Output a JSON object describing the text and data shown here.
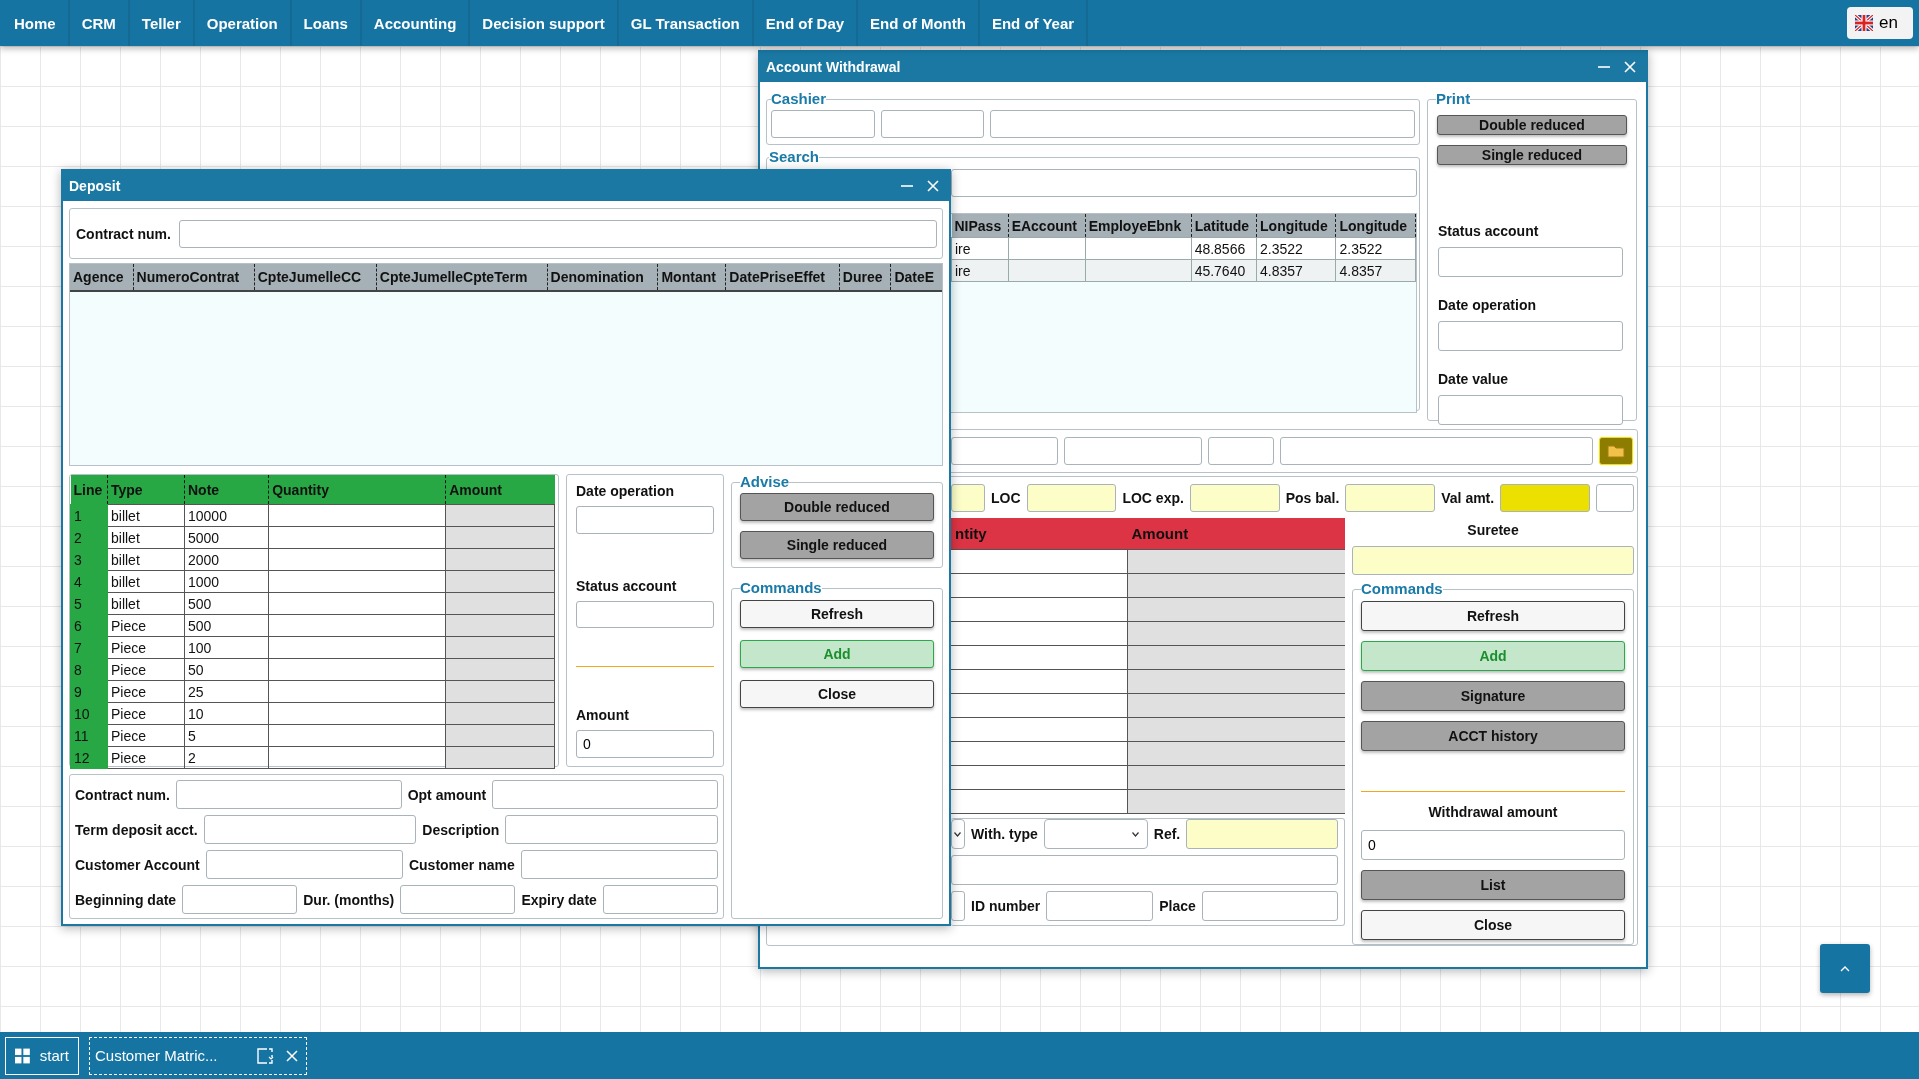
{
  "menu": [
    "Home",
    "CRM",
    "Teller",
    "Operation",
    "Loans",
    "Accounting",
    "Decision support",
    "GL Transaction",
    "End of Day",
    "End of Month",
    "End of Year"
  ],
  "language": {
    "code": "en"
  },
  "withdrawal_window": {
    "title": "Account Withdrawal",
    "cashier": {
      "legend": "Cashier"
    },
    "search": {
      "legend": "Search",
      "columns": [
        "NIPass",
        "EAccount",
        "EmployeEbnk",
        "Latitude",
        "Longitude",
        "Longitude"
      ],
      "rows": [
        [
          "ire",
          "",
          "",
          "48.8566",
          "2.3522",
          "2.3522"
        ],
        [
          "ire",
          "",
          "",
          "45.7640",
          "4.8357",
          "4.8357"
        ]
      ]
    },
    "print": {
      "legend": "Print",
      "buttons": [
        {
          "label": "Double reduced",
          "kind": "gray"
        },
        {
          "label": "Single reduced",
          "kind": "gray"
        }
      ],
      "fields": [
        "Status account",
        "Date operation",
        "Date value"
      ]
    },
    "balances": [
      {
        "label": "LOC",
        "color": "#fdfdc8"
      },
      {
        "label": "LOC exp.",
        "color": "#fdfdc8"
      },
      {
        "label": "Pos bal.",
        "color": "#fdfdc8"
      },
      {
        "label": "Val amt.",
        "color": "#ece000"
      }
    ],
    "notes_table": {
      "columns": [
        "ntity",
        "Amount"
      ]
    },
    "with_type": {
      "label": "With. type"
    },
    "ref": {
      "label": "Ref."
    },
    "id_number": {
      "label": "ID number"
    },
    "place": {
      "label": "Place"
    },
    "suretee": {
      "label": "Suretee"
    },
    "commands": {
      "legend": "Commands",
      "buttons": [
        {
          "label": "Refresh",
          "kind": "light"
        },
        {
          "label": "Add",
          "kind": "add"
        },
        {
          "label": "Signature",
          "kind": "gray"
        },
        {
          "label": "ACCT history",
          "kind": "gray"
        }
      ]
    },
    "withdrawal_amount": {
      "label": "Withdrawal amount",
      "value": "0"
    },
    "footer_buttons": [
      {
        "label": "List",
        "kind": "gray"
      },
      {
        "label": "Close",
        "kind": "light"
      }
    ]
  },
  "deposit_window": {
    "title": "Deposit",
    "contract": {
      "label": "Contract num."
    },
    "contracts_columns": [
      "Agence",
      "NumeroContrat",
      "CpteJumelleCC",
      "CpteJumelleCpteTerm",
      "Denomination",
      "Montant",
      "DatePriseEffet",
      "Duree",
      "DateE"
    ],
    "denominations": {
      "columns": [
        "Line",
        "Type",
        "Note",
        "Quantity",
        "Amount"
      ],
      "rows": [
        {
          "line": "1",
          "type": "billet",
          "note": "10000"
        },
        {
          "line": "2",
          "type": "billet",
          "note": "5000"
        },
        {
          "line": "3",
          "type": "billet",
          "note": "2000"
        },
        {
          "line": "4",
          "type": "billet",
          "note": "1000"
        },
        {
          "line": "5",
          "type": "billet",
          "note": "500"
        },
        {
          "line": "6",
          "type": "Piece",
          "note": "500"
        },
        {
          "line": "7",
          "type": "Piece",
          "note": "100"
        },
        {
          "line": "8",
          "type": "Piece",
          "note": "50"
        },
        {
          "line": "9",
          "type": "Piece",
          "note": "25"
        },
        {
          "line": "10",
          "type": "Piece",
          "note": "10"
        },
        {
          "line": "11",
          "type": "Piece",
          "note": "5"
        },
        {
          "line": "12",
          "type": "Piece",
          "note": "2"
        }
      ]
    },
    "date_operation": {
      "label": "Date operation"
    },
    "status_account": {
      "label": "Status account"
    },
    "amount": {
      "label": "Amount",
      "value": "0"
    },
    "advise": {
      "legend": "Advise",
      "buttons": [
        {
          "label": "Double reduced",
          "kind": "gray"
        },
        {
          "label": "Single reduced",
          "kind": "gray"
        }
      ]
    },
    "commands": {
      "legend": "Commands",
      "buttons": [
        {
          "label": "Refresh",
          "kind": "light"
        },
        {
          "label": "Add",
          "kind": "add"
        },
        {
          "label": "Close",
          "kind": "light"
        }
      ]
    },
    "details": [
      [
        "Contract num.",
        "Opt amount"
      ],
      [
        "Term deposit acct.",
        "Description"
      ],
      [
        "Customer Account",
        "Customer name"
      ],
      [
        "Beginning date",
        "Dur. (months)",
        "Expiry date"
      ]
    ]
  },
  "taskbar": {
    "start": "start",
    "tasks": [
      {
        "label": "Customer Matric..."
      }
    ]
  }
}
